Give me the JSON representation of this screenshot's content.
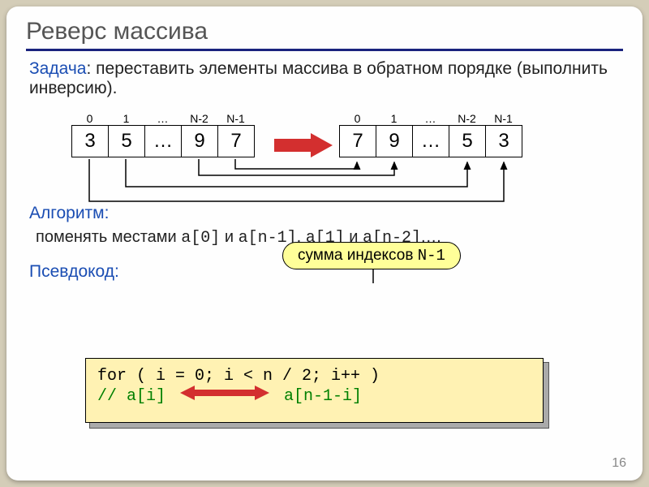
{
  "title": "Реверс массива",
  "task_label": "Задача",
  "task_text": ": переставить элементы массива в обратном порядке (выполнить инверсию).",
  "indices": [
    "0",
    "1",
    "…",
    "N-2",
    "N-1"
  ],
  "array_before": [
    "3",
    "5",
    "…",
    "9",
    "7"
  ],
  "array_after": [
    "7",
    "9",
    "…",
    "5",
    "3"
  ],
  "algo_label": "Алгоритм:",
  "swap_text_1": "поменять местами ",
  "swap_code_1": "a[0]",
  "swap_text_2": " и ",
  "swap_code_2": "a[n-1]",
  "swap_text_3": ", ",
  "swap_code_3": "a[1]",
  "swap_text_4": " и ",
  "swap_code_4": "a[n-2]",
  "swap_text_5": ",…",
  "tooltip_text": "сумма индексов ",
  "tooltip_code": "N-1",
  "pseudo_label": "Псевдокод:",
  "code_line1": "for ( i = 0; i < n / 2; i++ )",
  "code_comment_a": "// a[i]",
  "code_comment_b": "a[n-1-i]",
  "page_number": "16",
  "colors": {
    "background": "#d4cdb8",
    "slide": "#fefefe",
    "underline": "#1a237e",
    "blue_label": "#1a4db3",
    "tooltip_bg": "#ffff99",
    "code_bg": "#fff2b3",
    "arrow_red": "#d32f2f",
    "comment_green": "#008000"
  }
}
